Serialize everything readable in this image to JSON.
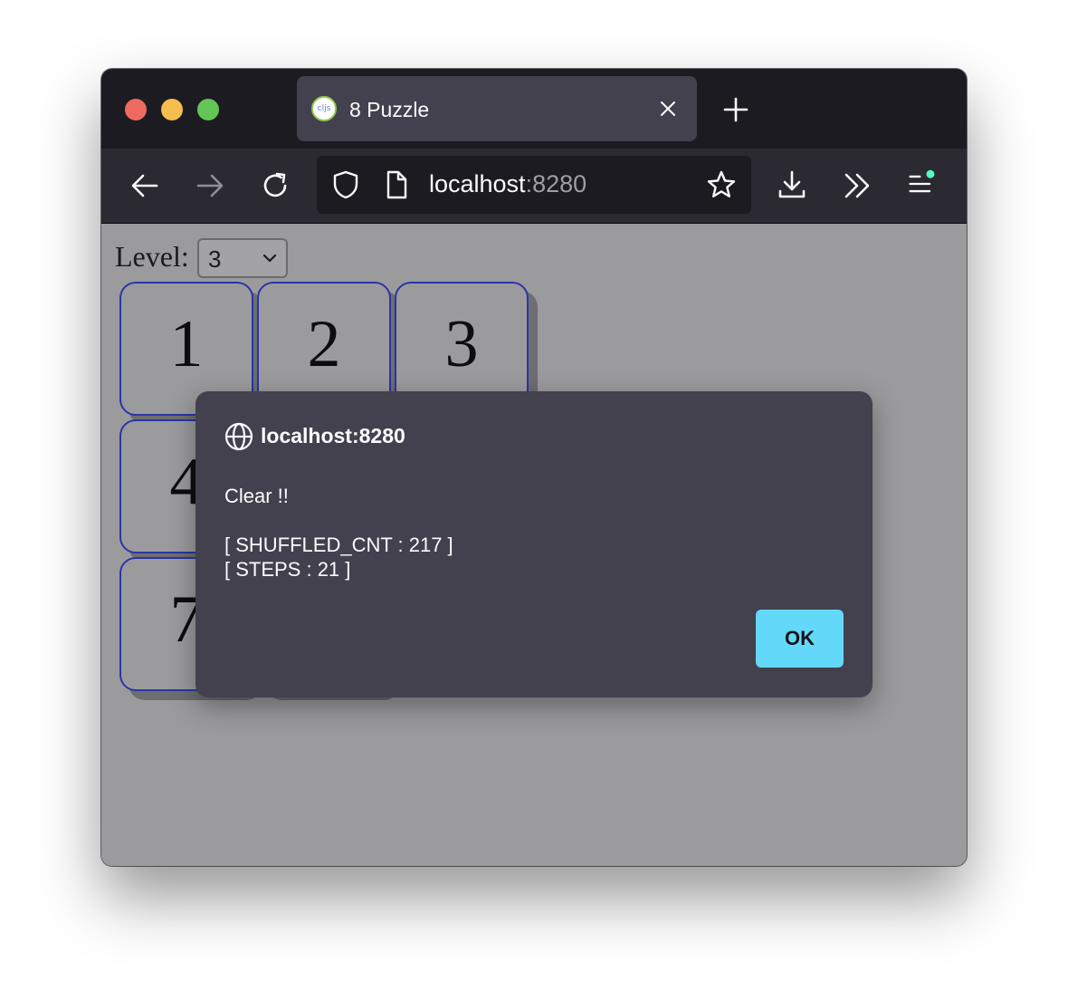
{
  "browser": {
    "tab": {
      "title": "8 Puzzle",
      "favicon_text": "cljs"
    },
    "url": {
      "host": "localhost",
      "port": ":8280"
    }
  },
  "page": {
    "level_label": "Level:",
    "level_value": "3",
    "tiles": [
      "1",
      "2",
      "3",
      "4",
      "7"
    ]
  },
  "dialog": {
    "origin": "localhost:8280",
    "line1": "Clear !!",
    "line2": "[ SHUFFLED_CNT : 217 ]",
    "line3": "[ STEPS : 21 ]",
    "ok_label": "OK"
  },
  "colors": {
    "tile_border": "#2a35a6",
    "ok_button": "#63d8f8",
    "dialog_bg": "#42414d"
  },
  "icons": [
    "back-icon",
    "forward-icon",
    "reload-icon",
    "shield-icon",
    "page-icon",
    "bookmark-star-icon",
    "download-icon",
    "overflow-icon",
    "menu-icon",
    "globe-icon",
    "close-icon",
    "plus-icon",
    "chevron-down-icon"
  ]
}
